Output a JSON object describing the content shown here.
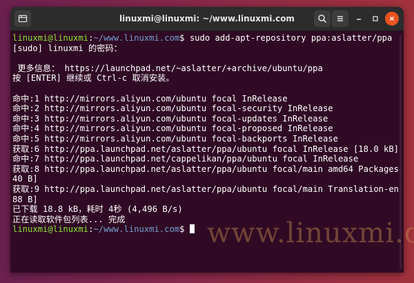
{
  "window": {
    "title": "linuxmi@linuxmi: ~/www.linuxmi.com",
    "new_tab_icon": "new-tab-icon",
    "search_icon": "search-icon",
    "menu_icon": "hamburger-menu-icon"
  },
  "colors": {
    "terminal_bg": "#300a24",
    "prompt_user": "#8ae234",
    "prompt_path": "#729fcf",
    "close_button": "#e95420"
  },
  "terminal": {
    "prompt_user": "linuxmi@linuxmi",
    "prompt_colon": ":",
    "prompt_path": "~/www.linuxmi.com",
    "prompt_symbol": "$",
    "command": " sudo add-apt-repository ppa:aslatter/ppa",
    "lines": [
      "[sudo] linuxmi 的密码：",
      "",
      " 更多信息： https://launchpad.net/~aslatter/+archive/ubuntu/ppa",
      "按 [ENTER] 继续或 Ctrl-c 取消安装。",
      "",
      "命中:1 http://mirrors.aliyun.com/ubuntu focal InRelease",
      "命中:2 http://mirrors.aliyun.com/ubuntu focal-security InRelease",
      "命中:3 http://mirrors.aliyun.com/ubuntu focal-updates InRelease",
      "命中:4 http://mirrors.aliyun.com/ubuntu focal-proposed InRelease",
      "命中:5 http://mirrors.aliyun.com/ubuntu focal-backports InRelease",
      "获取:6 http://ppa.launchpad.net/aslatter/ppa/ubuntu focal InRelease [18.0 kB]",
      "命中:7 http://ppa.launchpad.net/cappelikan/ppa/ubuntu focal InRelease",
      "获取:8 http://ppa.launchpad.net/aslatter/ppa/ubuntu focal/main amd64 Packages [5",
      "40 B]",
      "获取:9 http://ppa.launchpad.net/aslatter/ppa/ubuntu focal/main Translation-en [1",
      "88 B]",
      "已下载 18.8 kB，耗时 4秒 (4,496 B/s)",
      "正在读取软件包列表... 完成"
    ]
  },
  "watermark": "www.linuxmi.com"
}
